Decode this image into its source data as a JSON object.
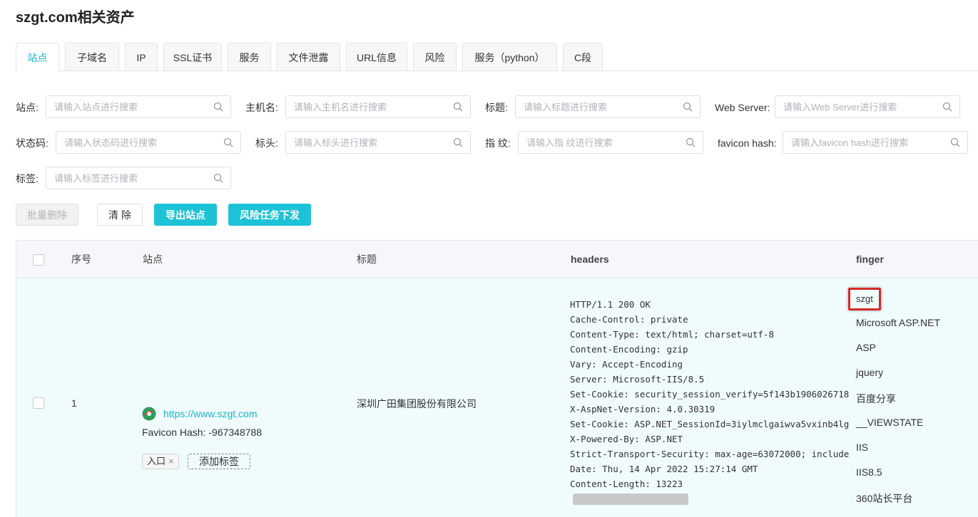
{
  "page": {
    "title": "szgt.com相关资产"
  },
  "tabs": [
    {
      "label": "站点",
      "active": true
    },
    {
      "label": "子域名"
    },
    {
      "label": "IP"
    },
    {
      "label": "SSL证书"
    },
    {
      "label": "服务"
    },
    {
      "label": "文件泄露"
    },
    {
      "label": "URL信息"
    },
    {
      "label": "风险"
    },
    {
      "label": "服务（python）"
    },
    {
      "label": "C段"
    }
  ],
  "filters": {
    "site": {
      "label": "站点:",
      "placeholder": "请输入站点进行搜索"
    },
    "hostname": {
      "label": "主机名:",
      "placeholder": "请输入主机名进行搜索"
    },
    "title": {
      "label": "标题:",
      "placeholder": "请输入标题进行搜索"
    },
    "webserver": {
      "label": "Web Server:",
      "placeholder": "请输入Web Server进行搜索"
    },
    "status": {
      "label": "状态码:",
      "placeholder": "请输入状态码进行搜索"
    },
    "header": {
      "label": "标头:",
      "placeholder": "请输入标头进行搜索"
    },
    "finger": {
      "label": "指 纹:",
      "placeholder": "请输入指 纹进行搜索"
    },
    "favicon": {
      "label": "favicon hash:",
      "placeholder": "请输入favicon hash进行搜索"
    },
    "tag": {
      "label": "标签:",
      "placeholder": "请输入标签进行搜索"
    }
  },
  "actions": {
    "batch_delete": "批量删除",
    "clear": "清 除",
    "export": "导出站点",
    "risk_task": "风险任务下发"
  },
  "table": {
    "columns": {
      "index": "序号",
      "site": "站点",
      "title": "标题",
      "headers": "headers",
      "finger": "finger"
    },
    "row": {
      "index": "1",
      "site_url": "https://www.szgt.com",
      "favicon_hash": "Favicon Hash: -967348788",
      "tag": "入口",
      "tag_remove": "×",
      "add_tag": "添加标签",
      "title": "深圳广田集团股份有限公司",
      "headers": "HTTP/1.1 200 OK\nCache-Control: private\nContent-Type: text/html; charset=utf-8\nContent-Encoding: gzip\nVary: Accept-Encoding\nServer: Microsoft-IIS/8.5\nSet-Cookie: security_session_verify=5f143b1906026718\nX-AspNet-Version: 4.0.30319\nSet-Cookie: ASP.NET_SessionId=3iylmclgaiwva5vxinb4lg\nX-Powered-By: ASP.NET\nStrict-Transport-Security: max-age=63072000; include\nDate: Thu, 14 Apr 2022 15:27:14 GMT\nContent-Length: 13223",
      "fingers": [
        "szgt",
        "Microsoft ASP.NET",
        "ASP",
        "jquery",
        "百度分享",
        "__VIEWSTATE",
        "IIS",
        "IIS8.5",
        "360站长平台"
      ]
    }
  },
  "colors": {
    "accent": "#1ec2d6",
    "highlight": "#d42b2b"
  }
}
